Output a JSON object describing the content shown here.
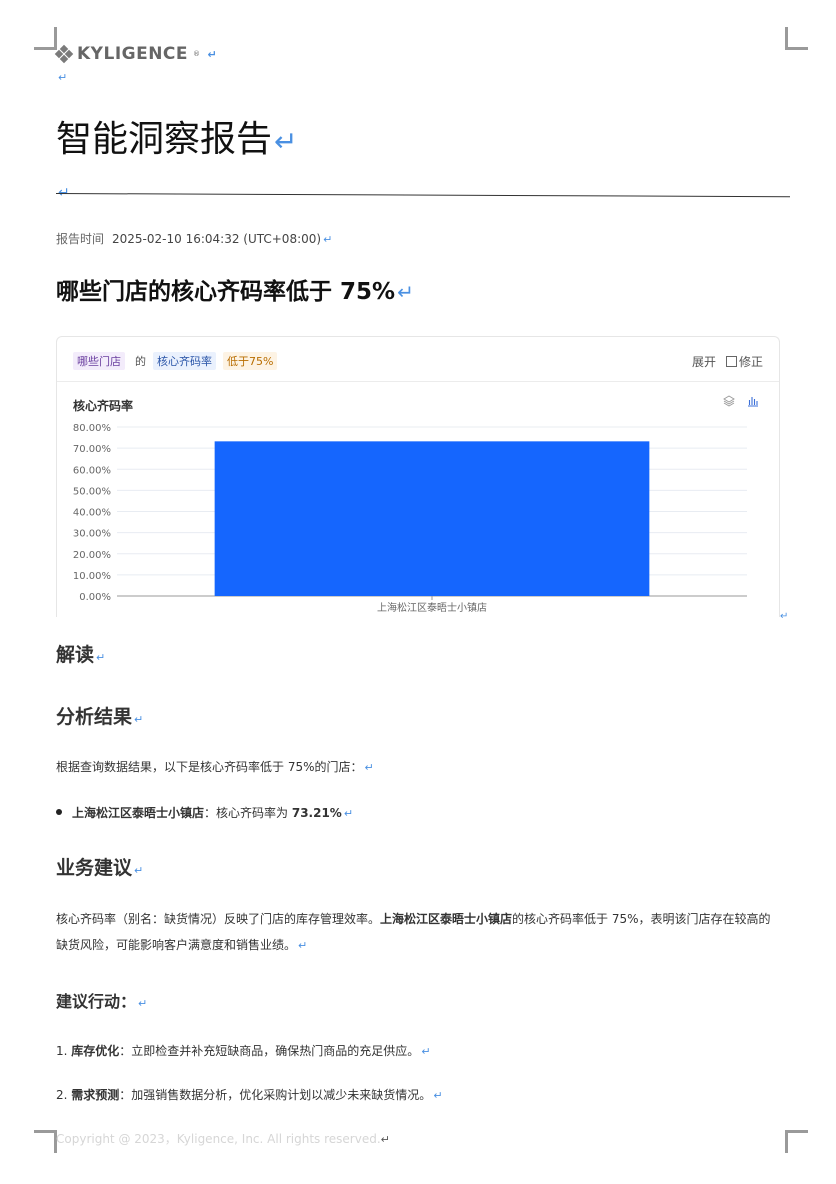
{
  "header": {
    "logo_text": "KYLIGENCE",
    "logo_reg": "®"
  },
  "report": {
    "title": "智能洞察报告",
    "time_label": "报告时间",
    "time_value": "2025-02-10 16:04:32 (UTC+08:00)",
    "question": "哪些门店的核心齐码率低于 75%"
  },
  "query_card": {
    "tag_dimension": "哪些门店",
    "tag_de": "的",
    "tag_metric": "核心齐码率",
    "tag_condition": "低于75%",
    "expand_label": "展开",
    "edit_label": "修正",
    "layers_icon": "layers-icon",
    "chart_type_icon": "bar-chart-icon"
  },
  "chart_data": {
    "type": "bar",
    "title": "核心齐码率",
    "categories": [
      "上海松江区泰晤士小镇店"
    ],
    "values": [
      73.21
    ],
    "ylim": [
      0,
      80
    ],
    "yticks": [
      "0.00%",
      "10.00%",
      "20.00%",
      "30.00%",
      "40.00%",
      "50.00%",
      "60.00%",
      "70.00%",
      "80.00%"
    ],
    "bar_color": "#1566fe",
    "grid": true
  },
  "analysis": {
    "heading": "解读",
    "result_heading": "分析结果",
    "result_intro": "根据查询数据结果，以下是核心齐码率低于 75%的门店：",
    "result_item_store": "上海松江区泰晤士小镇店",
    "result_item_text": "：核心齐码率为 ",
    "result_item_value": "73.21%"
  },
  "advice": {
    "heading": "业务建议",
    "para_part1": "核心齐码率（别名：缺货情况）反映了门店的库存管理效率。",
    "para_store": "上海松江区泰晤士小镇店",
    "para_part2": "的核心齐码率低于 75%，表明该门店存在较高的缺货风险，可能影响客户满意度和销售业绩。",
    "actions_heading": "建议行动：",
    "actions": [
      {
        "num": "1.",
        "title": "库存优化",
        "text": "：立即检查并补充短缺商品，确保热门商品的充足供应。"
      },
      {
        "num": "2.",
        "title": "需求预测",
        "text": "：加强销售数据分析，优化采购计划以减少未来缺货情况。"
      }
    ]
  },
  "footer": {
    "copyright": "Copyright @ 2023，Kyligence, Inc. All rights reserved."
  },
  "colors": {
    "accent": "#1566fe",
    "return_mark": "#4a90e2"
  }
}
